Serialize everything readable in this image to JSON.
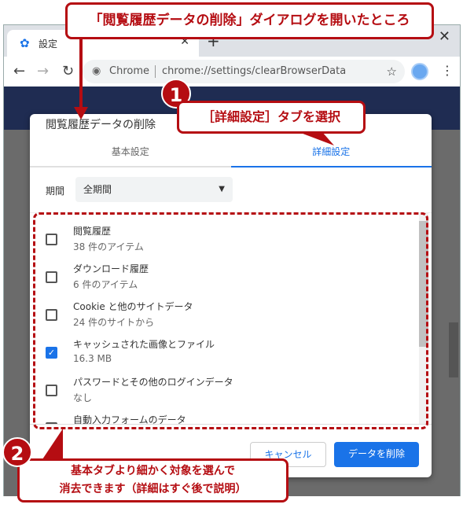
{
  "browser": {
    "tab_title": "設定",
    "tab_icon": "gear-icon",
    "omnibox_label": "Chrome",
    "url": "chrome://settings/clearBrowserData"
  },
  "dialog": {
    "title": "閲覧履歴データの削除",
    "tabs": [
      {
        "label": "基本設定",
        "active": false
      },
      {
        "label": "詳細設定",
        "active": true
      }
    ],
    "period_label": "期間",
    "period_value": "全期間",
    "items": [
      {
        "label": "閲覧履歴",
        "sub": "38 件のアイテム",
        "checked": false
      },
      {
        "label": "ダウンロード履歴",
        "sub": "6 件のアイテム",
        "checked": false
      },
      {
        "label": "Cookie と他のサイトデータ",
        "sub": "24 件のサイトから",
        "checked": false
      },
      {
        "label": "キャッシュされた画像とファイル",
        "sub": "16.3 MB",
        "checked": true
      },
      {
        "label": "パスワードとその他のログインデータ",
        "sub": "なし",
        "checked": false
      },
      {
        "label": "自動入力フォームのデータ",
        "sub": "",
        "checked": false
      }
    ],
    "cancel": "キャンセル",
    "delete": "データを削除"
  },
  "annotations": {
    "title": "「閲覧履歴データの削除」ダイアログを開いたところ",
    "n1": "1",
    "c1": "［詳細設定］タブを選択",
    "n2": "2",
    "c2_line1": "基本タブより細かく対象を選んで",
    "c2_line2": "消去できます（詳細はすぐ後で説明）"
  },
  "colors": {
    "accent": "#1a73e8",
    "annotation": "#b50d12"
  }
}
